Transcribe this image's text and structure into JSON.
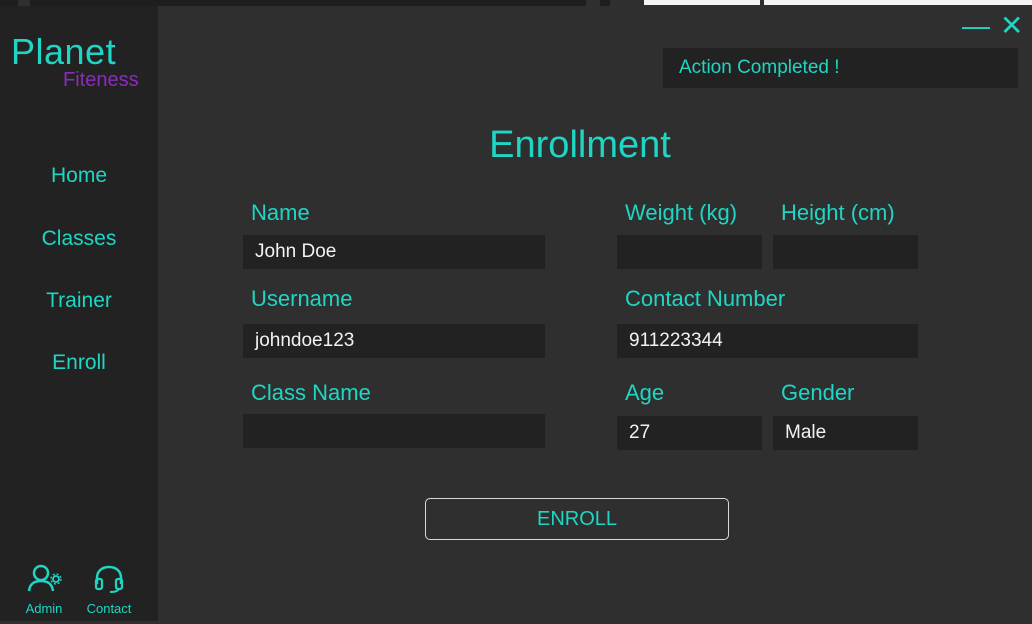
{
  "app": {
    "logo_main": "Planet",
    "logo_sub": "Fiteness"
  },
  "sidebar": {
    "items": [
      {
        "label": "Home"
      },
      {
        "label": "Classes"
      },
      {
        "label": "Trainer"
      },
      {
        "label": "Enroll"
      }
    ],
    "bottom": {
      "admin_label": "Admin",
      "contact_label": "Contact"
    }
  },
  "window": {
    "minimize": "—",
    "close": "✕"
  },
  "status": {
    "message": "Action Completed !"
  },
  "form": {
    "title": "Enrollment",
    "name": {
      "label": "Name",
      "value": "John Doe"
    },
    "username": {
      "label": "Username",
      "value": "johndoe123"
    },
    "class_name": {
      "label": "Class Name",
      "value": ""
    },
    "weight": {
      "label": "Weight (kg)",
      "value": ""
    },
    "height": {
      "label": "Height (cm)",
      "value": ""
    },
    "contact": {
      "label": "Contact Number",
      "value": "911223344"
    },
    "age": {
      "label": "Age",
      "value": "27"
    },
    "gender": {
      "label": "Gender",
      "value": "Male"
    },
    "submit_label": "ENROLL"
  },
  "colors": {
    "accent": "#1fd6c4",
    "brand_purple": "#8a2bbd",
    "background": "#2f2f2f",
    "sidebar": "#222222"
  },
  "icons": {
    "admin": "user-gear-icon",
    "contact": "headset-icon"
  }
}
